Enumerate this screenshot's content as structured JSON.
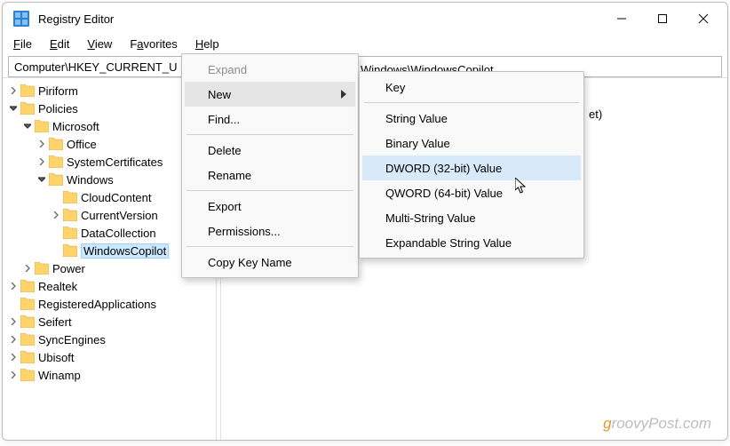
{
  "window": {
    "title": "Registry Editor"
  },
  "menubar": {
    "items": [
      {
        "label": "File",
        "u": "F"
      },
      {
        "label": "Edit",
        "u": "E"
      },
      {
        "label": "View",
        "u": "V"
      },
      {
        "label": "Favorites",
        "u": "a"
      },
      {
        "label": "Help",
        "u": "H"
      }
    ]
  },
  "addressbar": {
    "path": "Computer\\HKEY_CURRENT_U",
    "path_suffix": "Windows\\WindowsCopilot"
  },
  "value_pane": {
    "hint_suffix": "et)"
  },
  "tree": [
    {
      "label": "Piriform",
      "depth": 0,
      "exp": "closed"
    },
    {
      "label": "Policies",
      "depth": 0,
      "exp": "open"
    },
    {
      "label": "Microsoft",
      "depth": 1,
      "exp": "open"
    },
    {
      "label": "Office",
      "depth": 2,
      "exp": "closed"
    },
    {
      "label": "SystemCertificates",
      "depth": 2,
      "exp": "closed"
    },
    {
      "label": "Windows",
      "depth": 2,
      "exp": "open"
    },
    {
      "label": "CloudContent",
      "depth": 3,
      "exp": "none"
    },
    {
      "label": "CurrentVersion",
      "depth": 3,
      "exp": "closed"
    },
    {
      "label": "DataCollection",
      "depth": 3,
      "exp": "none"
    },
    {
      "label": "WindowsCopilot",
      "depth": 3,
      "exp": "none",
      "selected": true
    },
    {
      "label": "Power",
      "depth": 1,
      "exp": "closed"
    },
    {
      "label": "Realtek",
      "depth": 0,
      "exp": "closed"
    },
    {
      "label": "RegisteredApplications",
      "depth": 0,
      "exp": "none"
    },
    {
      "label": "Seifert",
      "depth": 0,
      "exp": "closed"
    },
    {
      "label": "SyncEngines",
      "depth": 0,
      "exp": "closed"
    },
    {
      "label": "Ubisoft",
      "depth": 0,
      "exp": "closed"
    },
    {
      "label": "Winamp",
      "depth": 0,
      "exp": "closed"
    }
  ],
  "context_menu_1": {
    "items": {
      "expand": "Expand",
      "new": "New",
      "find": "Find...",
      "delete": "Delete",
      "rename": "Rename",
      "export": "Export",
      "permissions": "Permissions...",
      "copy_key_name": "Copy Key Name"
    }
  },
  "context_menu_2": {
    "items": {
      "key": "Key",
      "string": "String Value",
      "binary": "Binary Value",
      "dword": "DWORD (32-bit) Value",
      "qword": "QWORD (64-bit) Value",
      "multi": "Multi-String Value",
      "expand": "Expandable String Value"
    }
  },
  "watermark": {
    "g": "g",
    "rest": "roovyPost.com"
  }
}
